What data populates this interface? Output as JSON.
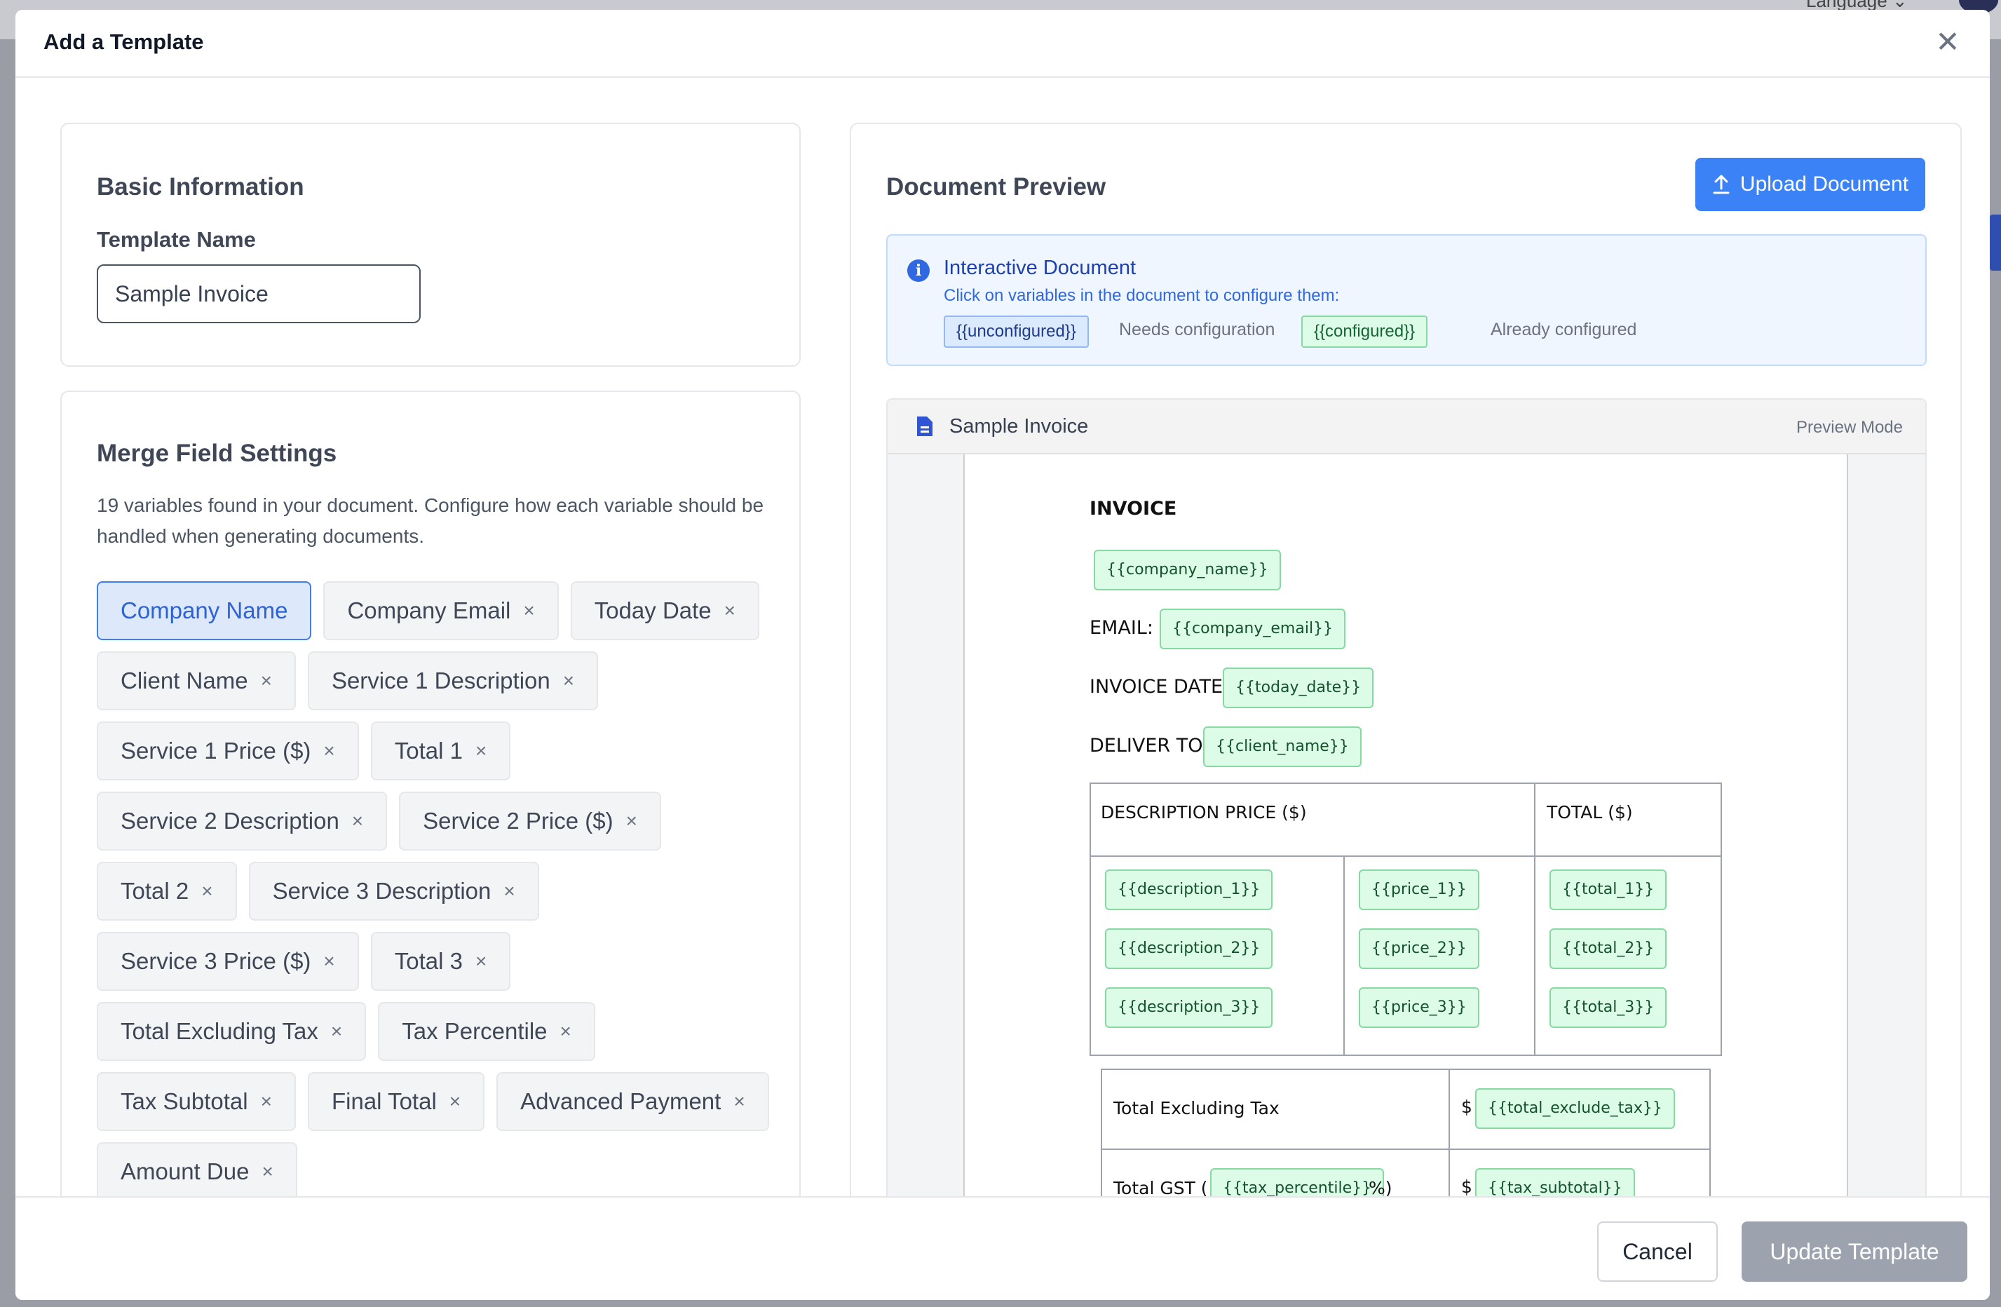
{
  "background": {
    "language_label": "Language ⌄"
  },
  "modal": {
    "title": "Add a Template",
    "close_glyph": "✕"
  },
  "basic_info": {
    "title": "Basic Information",
    "template_name_label": "Template Name",
    "template_name_value": "Sample Invoice"
  },
  "merge_fields": {
    "title": "Merge Field Settings",
    "description": "19 variables found in your document. Configure how each variable should be handled when generating documents.",
    "chips": [
      {
        "label": "Company Name",
        "active": true
      },
      {
        "label": "Company Email",
        "active": false
      },
      {
        "label": "Today Date",
        "active": false
      },
      {
        "label": "Client Name",
        "active": false
      },
      {
        "label": "Service 1 Description",
        "active": false
      },
      {
        "label": "Service 1 Price ($)",
        "active": false
      },
      {
        "label": "Total 1",
        "active": false
      },
      {
        "label": "Service 2 Description",
        "active": false
      },
      {
        "label": "Service 2 Price ($)",
        "active": false
      },
      {
        "label": "Total 2",
        "active": false
      },
      {
        "label": "Service 3 Description",
        "active": false
      },
      {
        "label": "Service 3 Price ($)",
        "active": false
      },
      {
        "label": "Total 3",
        "active": false
      },
      {
        "label": "Total Excluding Tax",
        "active": false
      },
      {
        "label": "Tax Percentile",
        "active": false
      },
      {
        "label": "Tax Subtotal",
        "active": false
      },
      {
        "label": "Final Total",
        "active": false
      },
      {
        "label": "Advanced Payment",
        "active": false
      },
      {
        "label": "Amount Due",
        "active": false
      }
    ],
    "remove_glyph": "×"
  },
  "preview": {
    "title": "Document Preview",
    "upload_button": "Upload Document",
    "info_title": "Interactive Document",
    "info_sub": "Click on variables in the document to configure them:",
    "legend_unconfigured": "{{unconfigured}}",
    "legend_unconfigured_text": "Needs configuration",
    "legend_configured": "{{configured}}",
    "legend_configured_text": "Already configured",
    "doc_name": "Sample Invoice",
    "mode": "Preview Mode"
  },
  "document": {
    "heading": "INVOICE",
    "company_name_var": "{{company_name}}",
    "email_label": "EMAIL:",
    "company_email_var": "{{company_email}}",
    "invoice_date_label": "INVOICE DATE:",
    "today_date_var": "{{today_date}}",
    "deliver_label": "DELIVER TO:",
    "client_name_var": "{{client_name}}",
    "col_desc_price": "DESCRIPTION PRICE ($)",
    "col_total": "TOTAL ($)",
    "descriptions": [
      "{{description_1}}",
      "{{description_2}}",
      "{{description_3}}"
    ],
    "prices": [
      "{{price_1}}",
      "{{price_2}}",
      "{{price_3}}"
    ],
    "totals": [
      "{{total_1}}",
      "{{total_2}}",
      "{{total_3}}"
    ],
    "total_excl_label": "Total Excluding Tax",
    "currency": "$",
    "total_exclude_var": "{{total_exclude_tax}}",
    "gst_label_pre": "Total GST (",
    "tax_percentile_var": "{{tax_percentile}}",
    "gst_label_post": "%)",
    "tax_subtotal_var": "{{tax_subtotal}}"
  },
  "footer": {
    "cancel": "Cancel",
    "update": "Update Template"
  },
  "colors": {
    "accent": "#3b82f6",
    "configured_bg": "#dcfce7",
    "unconfigured_bg": "#dbeafe",
    "disabled_button": "#9ca3af"
  }
}
